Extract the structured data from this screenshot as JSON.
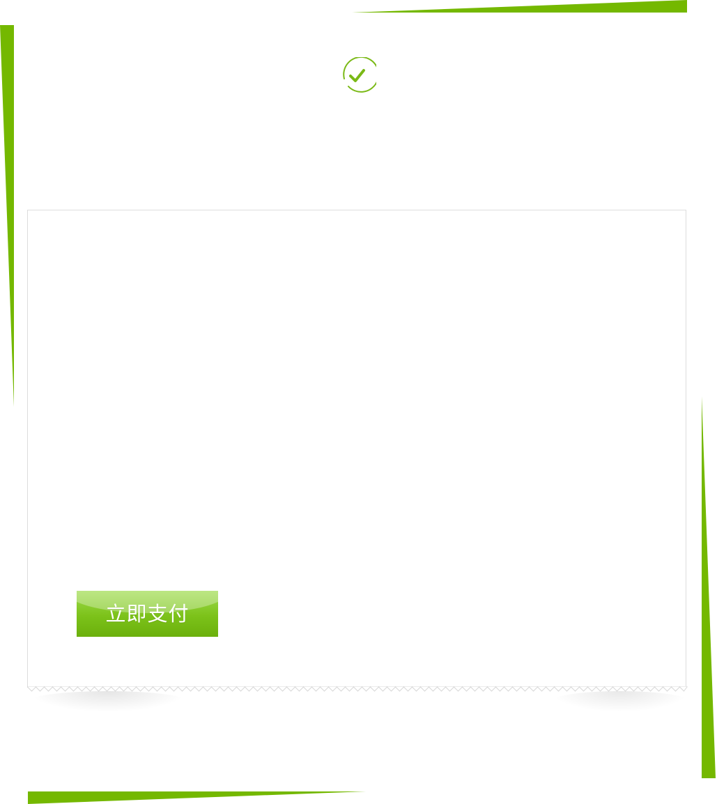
{
  "colors": {
    "accent": "#74b800",
    "check": "#7ab916",
    "button_top": "#9fdc4e",
    "button_bottom": "#6bb00c",
    "card_border": "#dddddd",
    "button_text": "#ffffff"
  },
  "icons": {
    "status": "checkmark-circle-icon"
  },
  "payment": {
    "pay_button_label": "立即支付"
  }
}
